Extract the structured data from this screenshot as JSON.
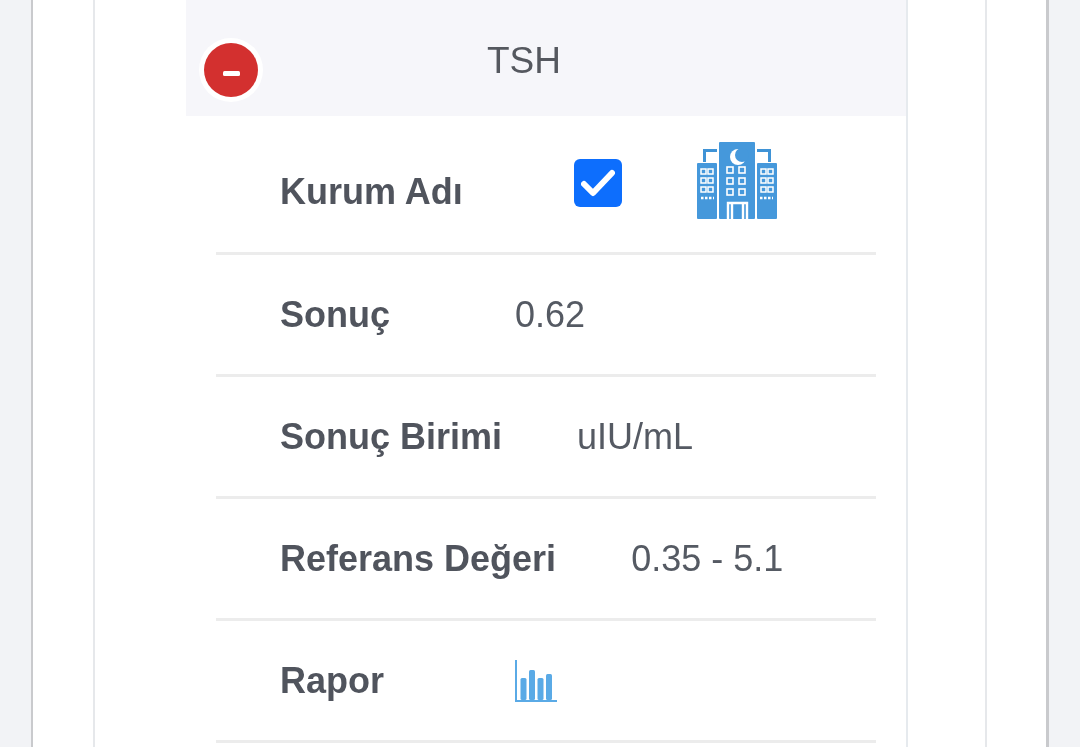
{
  "section": {
    "title": "TSH",
    "expanded": true
  },
  "rows": [
    {
      "kind": "checkbox",
      "label": "Kurum Adı",
      "checked": true
    },
    {
      "kind": "text",
      "label": "Sonuç",
      "value": "0.62"
    },
    {
      "kind": "text",
      "label": "Sonuç Birimi",
      "value": "uIU/mL"
    },
    {
      "kind": "text",
      "label": "Referans Değeri",
      "value": "0.35 - 5.1"
    },
    {
      "kind": "chart",
      "label": "Rapor"
    }
  ]
}
